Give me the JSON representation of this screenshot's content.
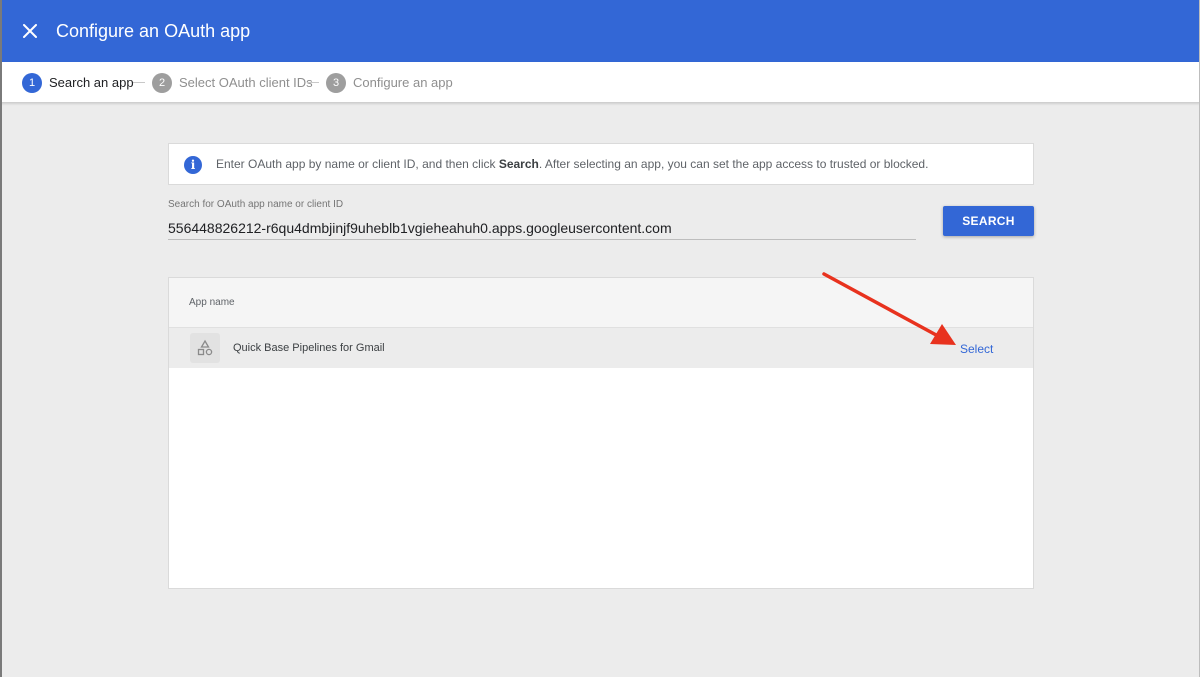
{
  "header": {
    "title": "Configure an OAuth app",
    "close_icon": "close-icon"
  },
  "stepper": {
    "steps": [
      {
        "number": "1",
        "label": "Search an app",
        "state": "active"
      },
      {
        "number": "2",
        "label": "Select OAuth client IDs",
        "state": "inactive"
      },
      {
        "number": "3",
        "label": "Configure an app",
        "state": "inactive"
      }
    ]
  },
  "info": {
    "text_before": "Enter OAuth app by name or client ID, and then click ",
    "text_bold": "Search",
    "text_after": ". After selecting an app, you can set the app access to trusted or blocked."
  },
  "search": {
    "label": "Search for OAuth app name or client ID",
    "value": "556448826212-r6qu4dmbjinjf9uheblb1vgieheahuh0.apps.googleusercontent.com",
    "button_label": "SEARCH"
  },
  "table": {
    "column_header": "App name",
    "rows": [
      {
        "icon": "shapes-icon",
        "name": "Quick Base Pipelines for Gmail",
        "action": "Select"
      }
    ]
  },
  "colors": {
    "primary": "#3367d6",
    "annotation_arrow": "#e8321e"
  }
}
